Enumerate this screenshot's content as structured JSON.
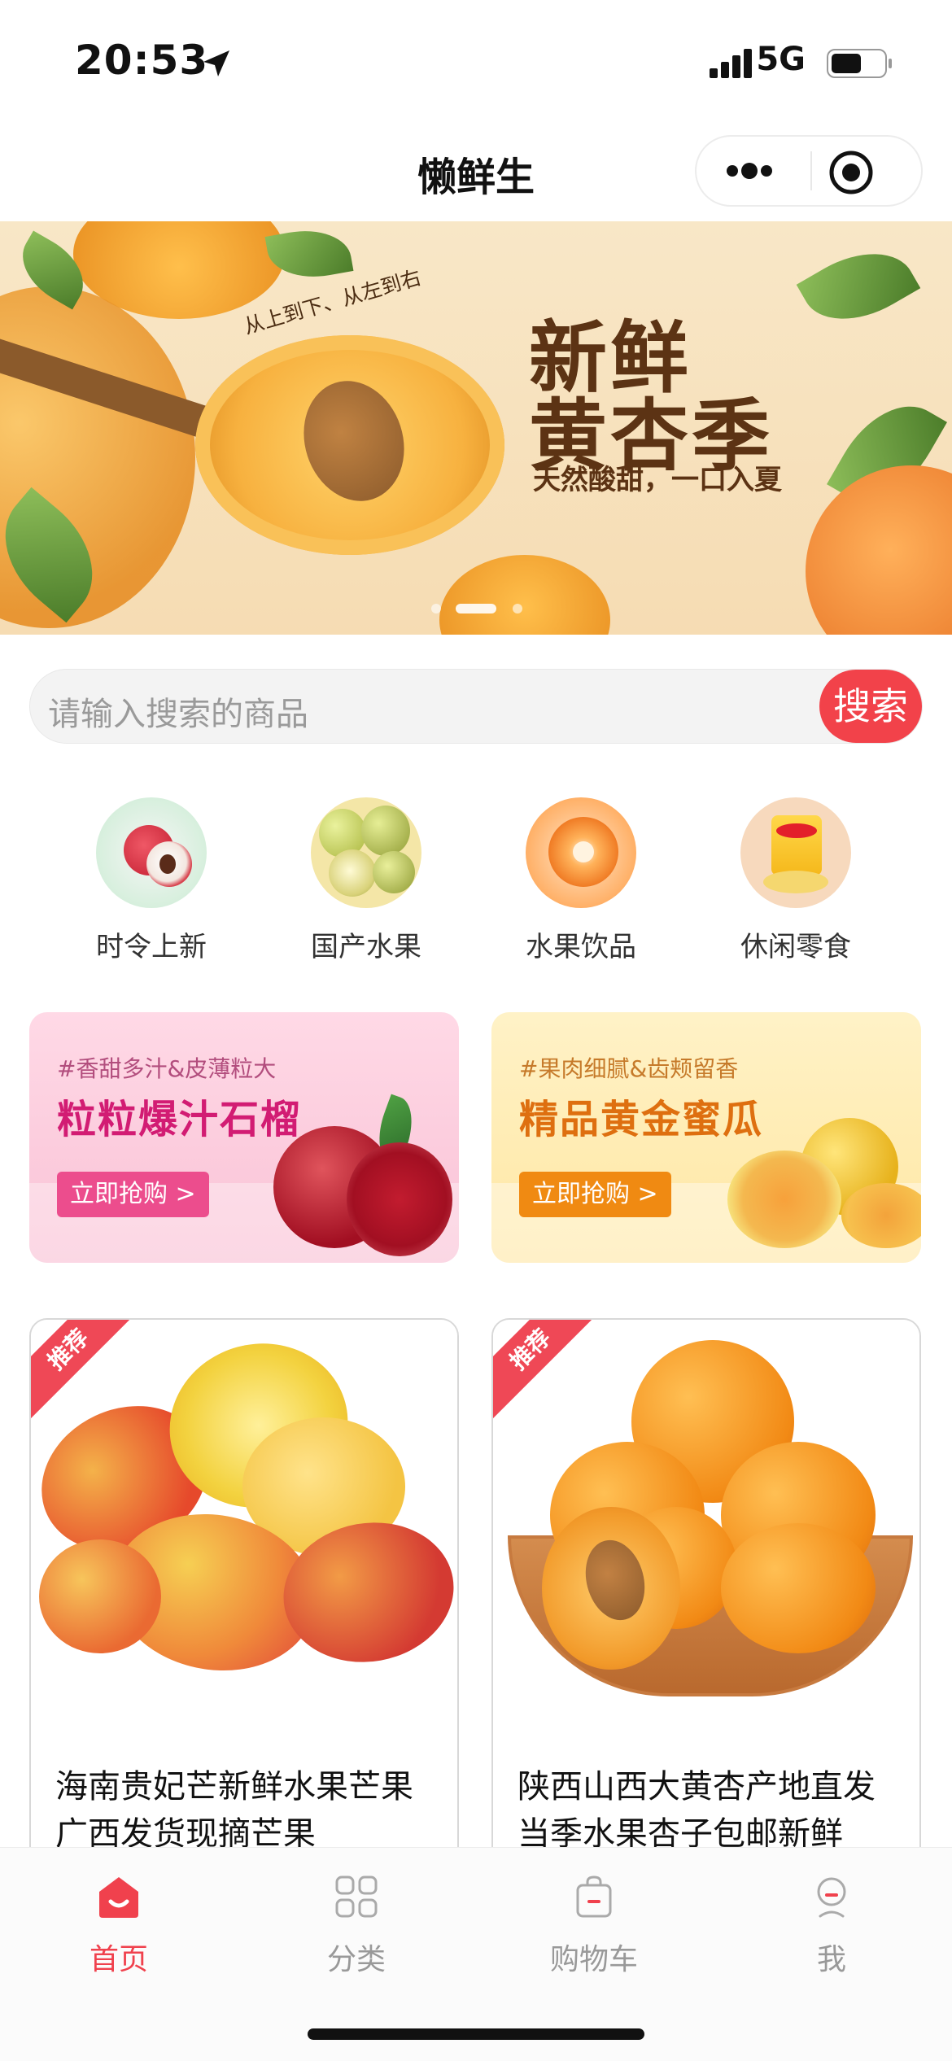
{
  "status_bar": {
    "time": "20:53",
    "network": "5G"
  },
  "navbar": {
    "title": "懒鲜生"
  },
  "banner": {
    "small_text": "从上到下、从左到右",
    "title_line1": "新鲜",
    "title_line2": "黄杏季",
    "subtitle": "天然酸甜，一口入夏"
  },
  "search": {
    "placeholder": "请输入搜索的商品",
    "button_label": "搜索"
  },
  "categories": [
    {
      "label": "时令上新",
      "icon": "lychee-icon"
    },
    {
      "label": "国产水果",
      "icon": "jujube-icon"
    },
    {
      "label": "水果饮品",
      "icon": "orange-drink-icon"
    },
    {
      "label": "休闲零食",
      "icon": "chips-icon"
    }
  ],
  "promos": [
    {
      "subtitle": "#香甜多汁&皮薄粒大",
      "title": "粒粒爆汁石榴",
      "button": "立即抢购 >"
    },
    {
      "subtitle": "#果肉细腻&齿颊留香",
      "title": "精品黄金蜜瓜",
      "button": "立即抢购 >"
    }
  ],
  "products": [
    {
      "badge": "推荐",
      "name": "海南贵妃芒新鲜水果芒果广西发货现摘芒果"
    },
    {
      "badge": "推荐",
      "name": "陕西山西大黄杏产地直发当季水果杏子包邮新鲜"
    }
  ],
  "tabbar": {
    "items": [
      {
        "label": "首页",
        "icon": "home-icon"
      },
      {
        "label": "分类",
        "icon": "grid-icon"
      },
      {
        "label": "购物车",
        "icon": "shopping-bag-icon"
      },
      {
        "label": "我",
        "icon": "user-icon"
      }
    ]
  },
  "colors": {
    "accent": "#f2424a",
    "banner_text": "#5c3314",
    "promo_pink_title": "#d21c73",
    "promo_orange_title": "#de6f10"
  }
}
